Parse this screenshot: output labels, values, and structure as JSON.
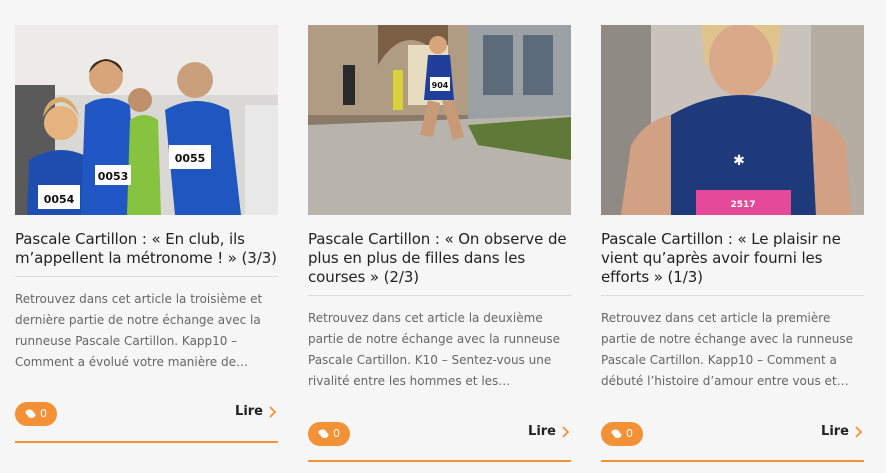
{
  "articles": [
    {
      "title": "Pascale Cartillon : « En club, ils m’appellent la métronome ! » (3/3)",
      "excerpt": "Retrouvez dans cet article la troisième et dernière partie de notre échange avec la runneuse Pascale Cartillon. Kapp10 – Comment a évolué votre manière de…",
      "comments": "0",
      "read_label": "Lire",
      "image": {
        "bibs": [
          "0054",
          "0053",
          "0055"
        ]
      }
    },
    {
      "title": "Pascale Cartillon : « On observe de plus en plus de filles dans les courses » (2/3)",
      "excerpt": "Retrouvez dans cet article la deuxième partie de notre échange avec la runneuse Pascale Cartillon. K10 – Sentez-vous une rivalité entre les hommes et les…",
      "comments": "0",
      "read_label": "Lire",
      "image": {
        "bibs": [
          "904"
        ]
      }
    },
    {
      "title": "Pascale Cartillon : « Le plaisir ne vient qu’après avoir fourni les efforts » (1/3)",
      "excerpt": "Retrouvez dans cet article la première partie de notre échange avec la runneuse Pascale Cartillon. Kapp10 – Comment a débuté l’histoire d’amour entre vous et…",
      "comments": "0",
      "read_label": "Lire",
      "image": {
        "bibs": [
          "2517"
        ]
      }
    }
  ],
  "colors": {
    "accent": "#f29135",
    "text": "#222222",
    "muted": "#666666"
  }
}
